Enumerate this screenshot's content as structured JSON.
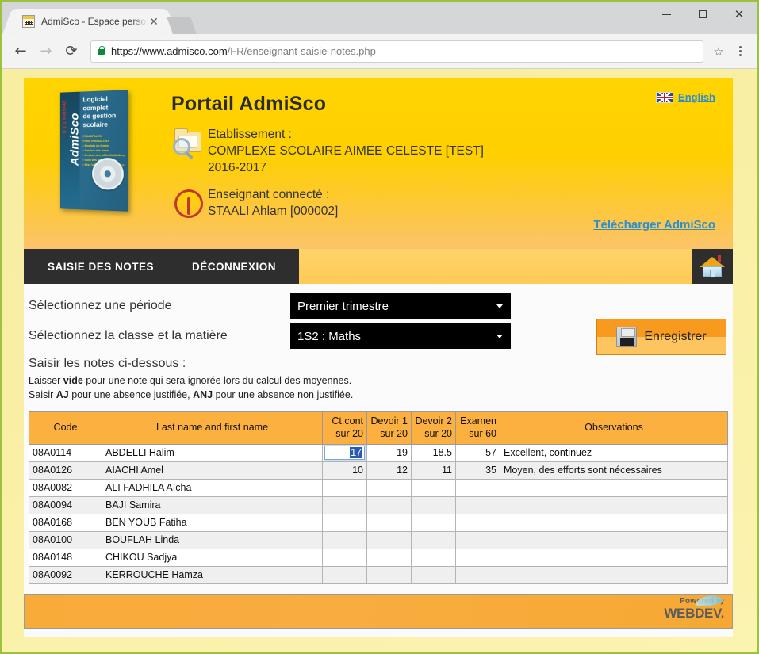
{
  "browser": {
    "tab_title": "AdmiSco - Espace person",
    "tab_close_label": "✕",
    "url_scheme": "https://www.admisco.com",
    "url_path": "/FR/enseignant-saisie-notes.php",
    "back_icon": "←",
    "forward_icon": "→",
    "reload_icon": "⟳",
    "star_icon": "☆",
    "minimize_label": "",
    "maximize_label": "",
    "close_label": "✕"
  },
  "header": {
    "title": "Portail AdmiSco",
    "logo": {
      "spine_text": "AdmiSco",
      "version_text": "Version 1.1.0",
      "face_heading": "Logiciel complet\nde gestion scolaire",
      "face_sub": "PRINCIPALES FONCTIONNALITES\n• Emplois du temps\n• Gestion des notes\n• Gestion des élèves"
    },
    "establishment_label": "Etablissement :",
    "establishment_name": "COMPLEXE SCOLAIRE AIMEE CELESTE [TEST]",
    "school_year": "2016-2017",
    "teacher_label": "Enseignant connecté :",
    "teacher_name": "STAALI Ahlam [000002]",
    "language_link": "English",
    "download_link": "Télécharger AdmiSco"
  },
  "nav": {
    "items": [
      {
        "label": "SAISIE DES NOTES"
      },
      {
        "label": "DÉCONNEXION"
      }
    ]
  },
  "form": {
    "period_label": "Sélectionnez une période",
    "period_value": "Premier trimestre",
    "class_label": "Sélectionnez la classe et la matière",
    "class_value": "1S2 : Maths",
    "instructions_title": "Saisir les notes ci-dessous :",
    "hint1_pre": "Laisser ",
    "hint1_bold": "vide",
    "hint1_post": " pour une note qui sera ignorée lors du calcul des moyennes.",
    "hint2_pre": "Saisir ",
    "hint2_bold1": "AJ",
    "hint2_mid": " pour une absence justifiée, ",
    "hint2_bold2": "ANJ",
    "hint2_post": " pour une absence non justifiée.",
    "save_label": "Enregistrer"
  },
  "table": {
    "columns": [
      {
        "line1": "Code",
        "line2": ""
      },
      {
        "line1": "Last name and first name",
        "line2": ""
      },
      {
        "line1": "Ct.cont",
        "line2": "sur 20"
      },
      {
        "line1": "Devoir 1",
        "line2": "sur 20"
      },
      {
        "line1": "Devoir 2",
        "line2": "sur 20"
      },
      {
        "line1": "Examen",
        "line2": "sur 60"
      },
      {
        "line1": "Observations",
        "line2": ""
      }
    ],
    "focused_cell_value": "17",
    "rows": [
      {
        "code": "08A0114",
        "name": "ABDELLI Halim",
        "ctcont": "17",
        "devoir1": "19",
        "devoir2": "18.5",
        "examen": "57",
        "observations": "Excellent, continuez",
        "focused": true
      },
      {
        "code": "08A0126",
        "name": "AIACHI Amel",
        "ctcont": "10",
        "devoir1": "12",
        "devoir2": "11",
        "examen": "35",
        "observations": "Moyen, des efforts sont nécessaires",
        "focused": false
      },
      {
        "code": "08A0082",
        "name": "ALI FADHILA Aïcha",
        "ctcont": "",
        "devoir1": "",
        "devoir2": "",
        "examen": "",
        "observations": "",
        "focused": false
      },
      {
        "code": "08A0094",
        "name": "BAJI Samira",
        "ctcont": "",
        "devoir1": "",
        "devoir2": "",
        "examen": "",
        "observations": "",
        "focused": false
      },
      {
        "code": "08A0168",
        "name": "BEN YOUB Fatiha",
        "ctcont": "",
        "devoir1": "",
        "devoir2": "",
        "examen": "",
        "observations": "",
        "focused": false
      },
      {
        "code": "08A0100",
        "name": "BOUFLAH Linda",
        "ctcont": "",
        "devoir1": "",
        "devoir2": "",
        "examen": "",
        "observations": "",
        "focused": false
      },
      {
        "code": "08A0148",
        "name": "CHIKOU Sadjya",
        "ctcont": "",
        "devoir1": "",
        "devoir2": "",
        "examen": "",
        "observations": "",
        "focused": false
      },
      {
        "code": "08A0092",
        "name": "KERROUCHE Hamza",
        "ctcont": "",
        "devoir1": "",
        "devoir2": "",
        "examen": "",
        "observations": "",
        "focused": false
      }
    ]
  },
  "footer": {
    "powered_by": "Powered",
    "by": "by",
    "brand": "WEBDEV."
  },
  "colors": {
    "header_yellow": "#ffd400",
    "nav_dark": "#2e2e2e",
    "accent_orange": "#fbb040",
    "link_blue": "#2a8fd0",
    "page_bg": "#f8eea2"
  }
}
